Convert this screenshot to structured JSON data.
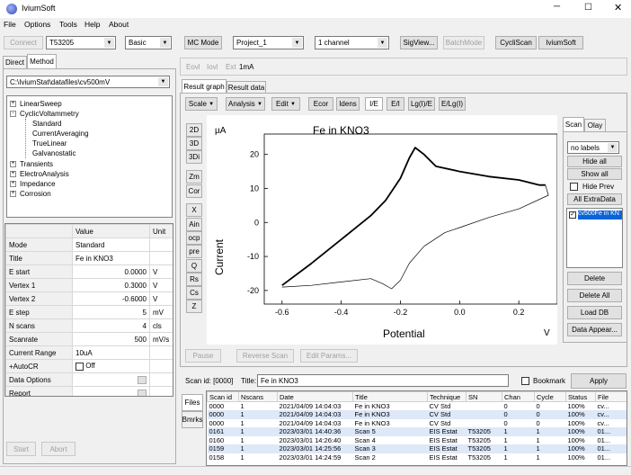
{
  "app": {
    "title": "IviumSoft"
  },
  "menu": [
    "File",
    "Options",
    "Tools",
    "Help",
    "About"
  ],
  "toolbar": {
    "connect": "Connect",
    "device": "T53205",
    "mode_level": "Basic",
    "mc_mode": "MC Mode",
    "project": "Project_1",
    "channel": "1 channel",
    "sigview": "SigView...",
    "batchmode": "BatchMode",
    "cyclicscan": "CycliScan",
    "iviumsoft": "IviumSoft"
  },
  "left_tabs": [
    "Direct",
    "Method"
  ],
  "method_path": "C:\\IviumStat\\datafiles\\cv500mV",
  "tree": [
    {
      "label": "LinearSweep",
      "level": 0,
      "exp": "+"
    },
    {
      "label": "CyclicVoltammetry",
      "level": 0,
      "exp": "-"
    },
    {
      "label": "Standard",
      "level": 1
    },
    {
      "label": "CurrentAveraging",
      "level": 1
    },
    {
      "label": "TrueLinear",
      "level": 1
    },
    {
      "label": "Galvanostatic",
      "level": 1
    },
    {
      "label": "Transients",
      "level": 0,
      "exp": "+"
    },
    {
      "label": "ElectroAnalysis",
      "level": 0,
      "exp": "+"
    },
    {
      "label": "Impedance",
      "level": 0,
      "exp": "+"
    },
    {
      "label": "Corrosion",
      "level": 0,
      "exp": "+"
    }
  ],
  "params": {
    "headers": [
      "",
      "Value",
      "Unit"
    ],
    "rows": [
      [
        "Mode",
        "Standard",
        ""
      ],
      [
        "Title",
        "Fe in KNO3",
        ""
      ],
      [
        "E start",
        "0.0000",
        "V"
      ],
      [
        "Vertex 1",
        "0.3000",
        "V"
      ],
      [
        "Vertex 2",
        "-0.6000",
        "V"
      ],
      [
        "E step",
        "5",
        "mV"
      ],
      [
        "N scans",
        "4",
        "cls"
      ],
      [
        "Scanrate",
        "500",
        "mV/s"
      ],
      [
        "Current Range",
        "10uA",
        ""
      ],
      [
        "+AutoCR",
        "Off",
        ""
      ],
      [
        "Data Options",
        "",
        ""
      ],
      [
        "Report",
        "",
        ""
      ]
    ]
  },
  "left_bottom": {
    "start": "Start",
    "abort": "Abort"
  },
  "status_labels": [
    "Eovl",
    "Iovl",
    "Ext",
    "1mA"
  ],
  "result_tabs": [
    "Result graph",
    "Result data"
  ],
  "graph_toolbar": {
    "scale": "Scale",
    "analysis": "Analysis",
    "edit": "Edit",
    "ecor": "Ecor",
    "idens": "Idens",
    "ie": "I/E",
    "ei": "E/I",
    "lgie": "Lg(I)/E",
    "elgi": "E/Lg(I)"
  },
  "view_buttons": [
    "2D",
    "3D",
    "3Di",
    "Zm",
    "Cor",
    "X",
    "Ain",
    "ocp",
    "pre",
    "Q",
    "Rs",
    "Cs",
    "Z"
  ],
  "chart_data": {
    "type": "line",
    "title": "Fe in KNO3",
    "unit_label": "µA",
    "xlabel": "Potential",
    "x_unit": "V",
    "ylabel": "Current",
    "xlim": [
      -0.66,
      0.33
    ],
    "ylim": [
      -24,
      26
    ],
    "xticks": [
      "-0.6",
      "-0.4",
      "-0.2",
      "0.0",
      "0.2"
    ],
    "xtick_values": [
      -0.6,
      -0.4,
      -0.2,
      0.0,
      0.2
    ],
    "yticks": [
      "20",
      "10",
      "0",
      "-10",
      "-20"
    ],
    "ytick_values": [
      20,
      10,
      0,
      -10,
      -20
    ],
    "series": [
      {
        "style": "thick",
        "x": [
          -0.6,
          -0.5,
          -0.4,
          -0.3,
          -0.25,
          -0.2,
          -0.17,
          -0.15,
          -0.12,
          -0.08,
          0.0,
          0.1,
          0.2,
          0.27,
          0.29
        ],
        "y": [
          -18.5,
          -12,
          -5,
          2,
          6.5,
          13,
          19,
          22,
          20,
          16.5,
          15,
          13.5,
          12.5,
          11,
          11
        ]
      },
      {
        "style": "thin",
        "x": [
          0.29,
          0.3,
          0.2,
          0.1,
          0.0,
          -0.05,
          -0.12,
          -0.17,
          -0.2,
          -0.23,
          -0.26,
          -0.3,
          -0.4,
          -0.5,
          -0.6
        ],
        "y": [
          11,
          8,
          4,
          1.5,
          -1.5,
          -3,
          -7,
          -12,
          -17,
          -19.5,
          -18,
          -16.5,
          -17.5,
          -18.5,
          -19
        ]
      }
    ]
  },
  "graph_bottom": {
    "pause": "Pause",
    "reverse": "Reverse Scan",
    "edit_params": "Edit Params..."
  },
  "scan_tabs": [
    "Scan",
    "Olay"
  ],
  "scan_panel": {
    "labels_select": "no labels",
    "hide_all": "Hide all",
    "show_all": "Show all",
    "hide_prev": "Hide Prev",
    "all_extradata": "All ExtraData",
    "scan_item": "cv500Fe in KN",
    "delete": "Delete",
    "delete_all": "Delete All",
    "load_db": "Load DB",
    "data_appear": "Data Appear..."
  },
  "scan_id_bar": {
    "scan_id": "Scan id: [0000]",
    "title_label": "Title:",
    "title_value": "Fe in KNO3",
    "bookmark": "Bookmark",
    "apply": "Apply"
  },
  "files_tabs": [
    "Files",
    "Bmrks"
  ],
  "files_table": {
    "headers": [
      "Scan id",
      "Nscans",
      "Date",
      "Title",
      "Technique",
      "SN",
      "Chan",
      "Cycle",
      "Status",
      "File"
    ],
    "rows": [
      [
        "0000",
        "1",
        "2021/04/09 14:04:03",
        "Fe in KNO3",
        "CV Std",
        "",
        "0",
        "0",
        "100%",
        "cv..."
      ],
      [
        "0000",
        "1",
        "2021/04/09 14:04:03",
        "Fe in KNO3",
        "CV Std",
        "",
        "0",
        "0",
        "100%",
        "cv..."
      ],
      [
        "0000",
        "1",
        "2021/04/09 14:04:03",
        "Fe in KNO3",
        "CV Std",
        "",
        "0",
        "0",
        "100%",
        "cv..."
      ],
      [
        "0161",
        "1",
        "2023/03/01 14:40:36",
        "Scan 5",
        "EIS Estat",
        "T53205",
        "1",
        "1",
        "100%",
        "01..."
      ],
      [
        "0160",
        "1",
        "2023/03/01 14:26:40",
        "Scan 4",
        "EIS Estat",
        "T53205",
        "1",
        "1",
        "100%",
        "01..."
      ],
      [
        "0159",
        "1",
        "2023/03/01 14:25:56",
        "Scan 3",
        "EIS Estat",
        "T53205",
        "1",
        "1",
        "100%",
        "01..."
      ],
      [
        "0158",
        "1",
        "2023/03/01 14:24:59",
        "Scan 2",
        "EIS Estat",
        "T53205",
        "1",
        "1",
        "100%",
        "01..."
      ]
    ]
  }
}
